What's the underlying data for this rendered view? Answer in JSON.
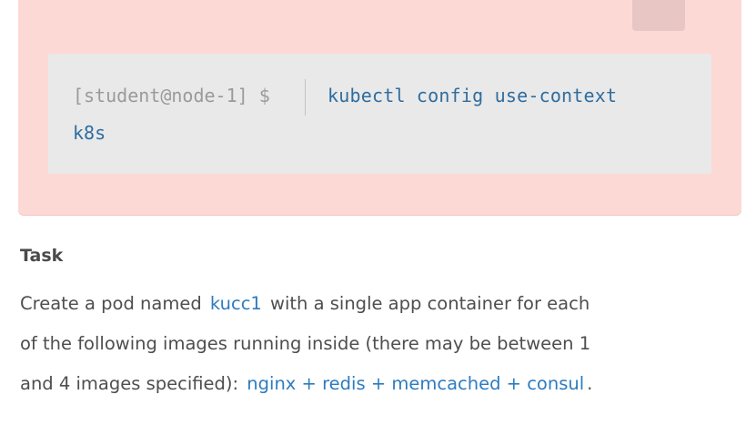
{
  "terminal": {
    "prompt": "[student@node-1] $",
    "command_line1": "kubectl config use-context",
    "command_line2": "k8s"
  },
  "task": {
    "heading": "Task",
    "line1_prefix": "Create a pod named",
    "pod_name": "kucc1",
    "line1_suffix": "with a single app container for each",
    "line2": "of the following images running inside (there may be between 1",
    "line3_prefix": "and 4 images specified):",
    "images_text": "nginx + redis + memcached + consul",
    "line3_suffix": "."
  },
  "colors": {
    "alert_background": "#fdd9d6",
    "code_background": "#e9e9e9",
    "command_text": "#2f6d9f",
    "inline_code_text": "#2e7bbf",
    "body_text": "#4e4e4e"
  }
}
